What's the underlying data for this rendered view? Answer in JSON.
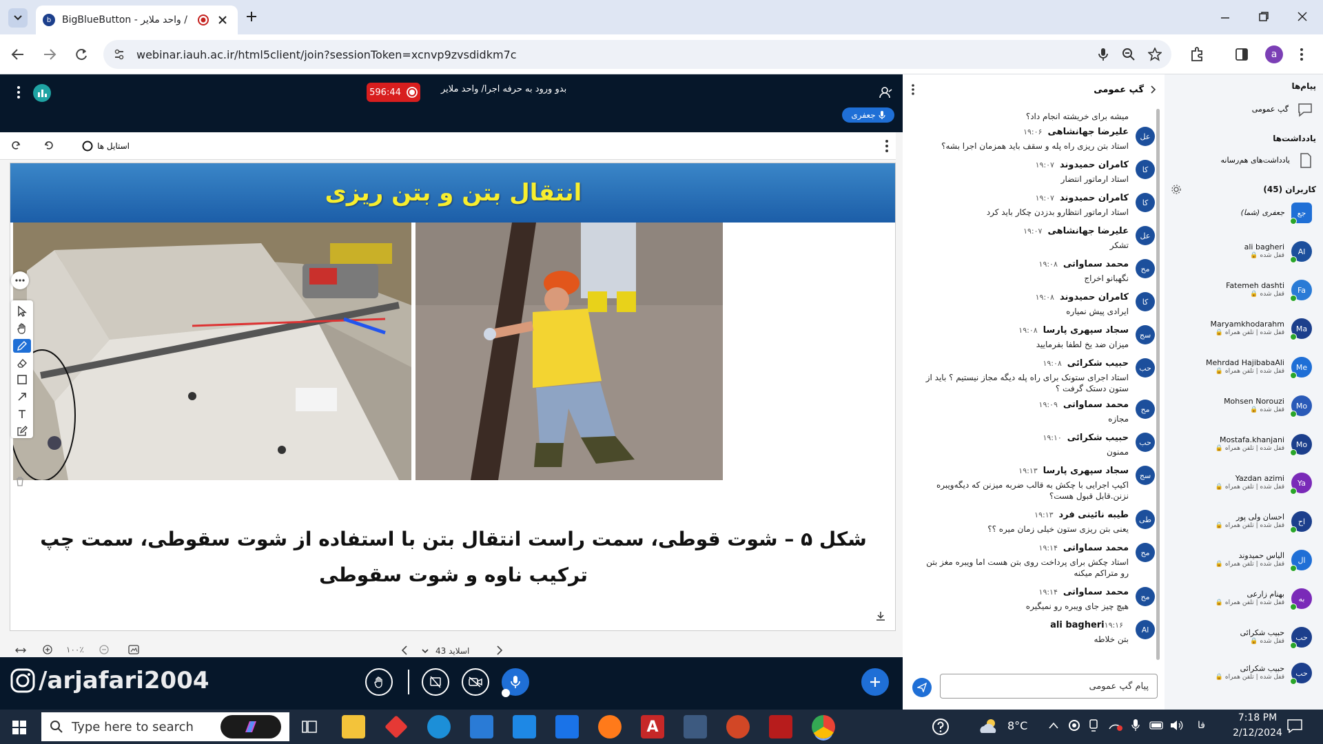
{
  "browser": {
    "tab_title": "BigBlueButton - واحد ملایر /",
    "url": "webinar.iauh.ac.ir/html5client/join?sessionToken=xcnvp9zvsdidkm7c"
  },
  "meeting": {
    "title": "بدو ورود به حرفه اجرا/ واحد ملایر",
    "timer": "596:44",
    "talking_user": "جعفری",
    "watermark": "/arjafari2004"
  },
  "presentation": {
    "styles_label": "استایل ها",
    "slide_title": "انتقال بتن و بتن ریزی",
    "caption_line1": "شکل ۵ – شوت قوطی، سمت راست انتقال بتن با استفاده از شوت سقوطی، سمت چپ",
    "caption_line2": "ترکیب ناوه و شوت سقوطی",
    "zoom": "۱۰۰٪",
    "slide_label": "اسلاید 43"
  },
  "chat": {
    "header": "گپ عمومی",
    "input_placeholder": "پیام گپ عمومی",
    "partial_top": "میشه برای خریشته انجام داد؟",
    "messages": [
      {
        "avatar": "عل",
        "name": "علیرضا جهانشاهی",
        "time": "۱۹:۰۶",
        "text": "استاد بتن ریزی راه پله و سقف باید همزمان اجرا بشه؟"
      },
      {
        "avatar": "کا",
        "name": "کامران حمیدوند",
        "time": "۱۹:۰۷",
        "text": "استاد ارماتور انتضار"
      },
      {
        "avatar": "کا",
        "name": "کامران حمیدوند",
        "time": "۱۹:۰۷",
        "text": "استاد ارماتور انتظارو بدزدن چکار باید کرد"
      },
      {
        "avatar": "عل",
        "name": "علیرضا جهانشاهی",
        "time": "۱۹:۰۷",
        "text": "تشکر"
      },
      {
        "avatar": "مح",
        "name": "محمد سماواتی",
        "time": "۱۹:۰۸",
        "text": "نگهبانو اخراج"
      },
      {
        "avatar": "کا",
        "name": "کامران حمیدوند",
        "time": "۱۹:۰۸",
        "text": "ایرادی پیش نمیاره"
      },
      {
        "avatar": "سج",
        "name": "سجاد سپهری پارسا",
        "time": "۱۹:۰۸",
        "text": "میزان ضد یخ لطفا بفرمایید"
      },
      {
        "avatar": "حب",
        "name": "حبیب شکرائی",
        "time": "۱۹:۰۸",
        "text": "استاد اجرای ستونک برای راه پله دیگه مجاز نیستیم ؟ باید از ستون دستک گرفت ؟"
      },
      {
        "avatar": "مح",
        "name": "محمد سماواتی",
        "time": "۱۹:۰۹",
        "text": "مجازه"
      },
      {
        "avatar": "حب",
        "name": "حبیب شکرائی",
        "time": "۱۹:۱۰",
        "text": "ممنون"
      },
      {
        "avatar": "سج",
        "name": "سجاد سپهری پارسا",
        "time": "۱۹:۱۳",
        "text": "اکیپ اجرایی با چکش به قالب ضربه میزنن که دیگه‌ویبره نزنن.قابل قبول هست؟"
      },
      {
        "avatar": "طی",
        "name": "طیبه نائینی فرد",
        "time": "۱۹:۱۳",
        "text": "یعنی بتن ریزی ستون خیلی زمان میره ؟؟"
      },
      {
        "avatar": "مح",
        "name": "محمد سماواتی",
        "time": "۱۹:۱۴",
        "text": "استاد چکش برای پرداخت روی بتن هست اما ویبره مغز بتن رو متراکم میکنه"
      },
      {
        "avatar": "مح",
        "name": "محمد سماواتی",
        "time": "۱۹:۱۴",
        "text": "هیچ چیز جای ویبره رو نمیگیره"
      },
      {
        "avatar": "Al",
        "name": "ali bagheri",
        "time": "۱۹:۱۶",
        "text": "بتن خلاطه"
      }
    ]
  },
  "sidebar": {
    "messages_label": "پیام‌ها",
    "public_chat_label": "گپ عمومی",
    "notes_header": "یادداشت‌ها",
    "shared_notes_label": "یادداشت‌های هم‌رسانه",
    "users_header": "کاربران (45)",
    "users": [
      {
        "avatar": "جع",
        "name": "جعفری (شما)",
        "status": "",
        "color": "#1f6fd6"
      },
      {
        "avatar": "Al",
        "name": "ali bagheri",
        "status": "قفل شده 🔒",
        "color": "#1c4f9c"
      },
      {
        "avatar": "Fa",
        "name": "Fatemeh dashti",
        "status": "قفل شده 🔒",
        "color": "#2a7bd6"
      },
      {
        "avatar": "Ma",
        "name": "Maryamkhodarahm",
        "status": "قفل شده | تلفن همراه 🔒",
        "color": "#1c3f8c"
      },
      {
        "avatar": "Me",
        "name": "Mehrdad HajibabaAli",
        "status": "قفل شده | تلفن همراه 🔒",
        "color": "#1f6fd6"
      },
      {
        "avatar": "Mo",
        "name": "Mohsen Norouzi",
        "status": "قفل شده 🔒",
        "color": "#2a5ab8"
      },
      {
        "avatar": "Mo",
        "name": "Mostafa.khanjani",
        "status": "قفل شده | تلفن همراه 🔒",
        "color": "#1c3f8c"
      },
      {
        "avatar": "Ya",
        "name": "Yazdan azimi",
        "status": "قفل شده | تلفن همراه 🔒",
        "color": "#7a2ab8"
      },
      {
        "avatar": "اح",
        "name": "احسان ولی پور",
        "status": "قفل شده | تلفن همراه 🔒",
        "color": "#1c3f8c"
      },
      {
        "avatar": "ال",
        "name": "الیاس حمیدوند",
        "status": "قفل شده | تلفن همراه 🔒",
        "color": "#1f6fd6"
      },
      {
        "avatar": "به",
        "name": "بهنام زارعی",
        "status": "قفل شده | تلفن همراه 🔒",
        "color": "#7a2ab8"
      },
      {
        "avatar": "حب",
        "name": "حبیب شکرائی",
        "status": "قفل شده 🔒",
        "color": "#1c3f8c"
      },
      {
        "avatar": "حب",
        "name": "حبیب شکرائی",
        "status": "قفل شده | تلفن همراه 🔒",
        "color": "#1c3f8c"
      }
    ]
  },
  "taskbar": {
    "search_placeholder": "Type here to search",
    "weather": "8°C",
    "lang": "فا",
    "time": "7:18 PM",
    "date": "2/12/2024"
  }
}
